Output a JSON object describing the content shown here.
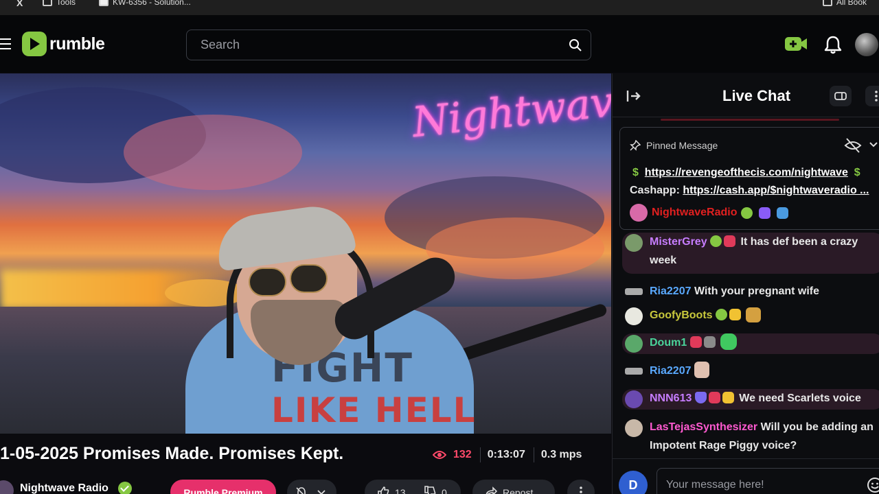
{
  "browser": {
    "bookmarks": [
      {
        "label": "X"
      },
      {
        "label": "Tools"
      },
      {
        "label": "KW-6356 - Solution..."
      },
      {
        "label": "All Book"
      }
    ]
  },
  "header": {
    "logo_text": "rumble",
    "search_placeholder": "Search"
  },
  "video": {
    "overlay_brand": "Nightwave",
    "shirt_line1": "FIGHT",
    "shirt_line2": "LIKE HELL",
    "title": "1-05-2025 Promises Made. Promises Kept.",
    "viewers": "132",
    "elapsed": "0:13:07",
    "bitrate": "0.3 mps"
  },
  "channel": {
    "name": "Nightwave Radio",
    "premium_label": "Rumble Premium",
    "upvotes": "13",
    "downvotes": "0",
    "repost_label": "Repost"
  },
  "chat": {
    "title": "Live Chat",
    "pinned": {
      "label": "Pinned Message",
      "line1_link": "https://revengeofthecis.com/nightwave",
      "line2_prefix": "Cashapp: ",
      "line2_link": "https://cash.app/$nightwaveradio ...",
      "author": "NightwaveRadio"
    },
    "messages": [
      {
        "user": "MisterGrey",
        "color": "#c77dff",
        "text": "It has def been a crazy week"
      },
      {
        "user": "Ria2207",
        "color": "#5aa9ff",
        "text": "With your pregnant wife"
      },
      {
        "user": "GoofyBoots",
        "color": "#c8c83c",
        "text": ""
      },
      {
        "user": "Doum1",
        "color": "#4ad39a",
        "text": ""
      },
      {
        "user": "Ria2207",
        "color": "#5aa9ff",
        "text": ""
      },
      {
        "user": "NNN613",
        "color": "#c77dff",
        "text": "We need Scarlets voice"
      },
      {
        "user": "LasTejasSynthesizer",
        "color": "#ff5ad0",
        "text": "Will you be adding an Impotent Rage Piggy voice?"
      }
    ],
    "composer": {
      "avatar_letter": "D",
      "placeholder": "Your message here!"
    }
  },
  "colors": {
    "brand_green": "#85c742",
    "accent_pink": "#e6306b",
    "viewer_red": "#ff4a6a",
    "pinned_author_red": "#e02020"
  }
}
